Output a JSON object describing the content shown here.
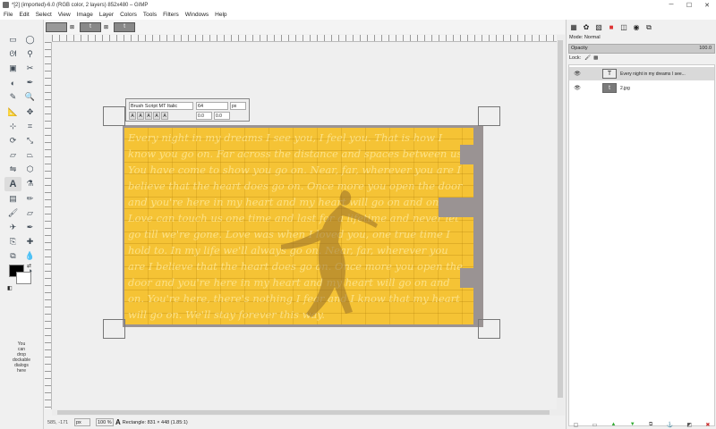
{
  "window": {
    "title": "*[2] (imported)-6.0 (RGB color, 2 layers) 852x480 – GIMP",
    "controls": {
      "minimize": "─",
      "maximize": "☐",
      "close": "✕"
    }
  },
  "menu": [
    "File",
    "Edit",
    "Select",
    "View",
    "Image",
    "Layer",
    "Colors",
    "Tools",
    "Filters",
    "Windows",
    "Help"
  ],
  "image_tabs": [
    {
      "glyph": "",
      "close": "⊠"
    },
    {
      "glyph": "t",
      "close": "⊠"
    },
    {
      "glyph": "t",
      "close": ""
    }
  ],
  "toolbox": {
    "tools": [
      {
        "name": "rect-select-icon",
        "glyph": "▭"
      },
      {
        "name": "ellipse-select-icon",
        "glyph": "◯"
      },
      {
        "name": "free-select-icon",
        "glyph": "ᘛ"
      },
      {
        "name": "fuzzy-select-icon",
        "glyph": "⚲"
      },
      {
        "name": "color-select-icon",
        "glyph": "▣"
      },
      {
        "name": "scissors-icon",
        "glyph": "✂"
      },
      {
        "name": "foreground-select-icon",
        "glyph": "◐"
      },
      {
        "name": "paths-icon",
        "glyph": "✒"
      },
      {
        "name": "color-picker-icon",
        "glyph": "✎"
      },
      {
        "name": "zoom-icon",
        "glyph": "🔍"
      },
      {
        "name": "measure-icon",
        "glyph": "📐"
      },
      {
        "name": "move-icon",
        "glyph": "✥"
      },
      {
        "name": "align-icon",
        "glyph": "⊹"
      },
      {
        "name": "crop-icon",
        "glyph": "⌗"
      },
      {
        "name": "rotate-icon",
        "glyph": "⟳"
      },
      {
        "name": "scale-icon",
        "glyph": "⤡"
      },
      {
        "name": "shear-icon",
        "glyph": "▱"
      },
      {
        "name": "perspective-icon",
        "glyph": "⏢"
      },
      {
        "name": "flip-icon",
        "glyph": "⇋"
      },
      {
        "name": "cage-icon",
        "glyph": "⬡"
      },
      {
        "name": "text-icon",
        "glyph": "A"
      },
      {
        "name": "bucket-fill-icon",
        "glyph": "⚗"
      },
      {
        "name": "blend-icon",
        "glyph": "▤"
      },
      {
        "name": "pencil-icon",
        "glyph": "✏"
      },
      {
        "name": "paintbrush-icon",
        "glyph": "🖌"
      },
      {
        "name": "eraser-icon",
        "glyph": "▱"
      },
      {
        "name": "airbrush-icon",
        "glyph": "✈"
      },
      {
        "name": "ink-icon",
        "glyph": "✒"
      },
      {
        "name": "clone-icon",
        "glyph": "⎘"
      },
      {
        "name": "heal-icon",
        "glyph": "✚"
      },
      {
        "name": "perspective-clone-icon",
        "glyph": "⧉"
      },
      {
        "name": "blur-icon",
        "glyph": "💧"
      },
      {
        "name": "smudge-icon",
        "glyph": "☝"
      },
      {
        "name": "dodge-burn-icon",
        "glyph": "◑"
      }
    ],
    "active_tool": "text-icon",
    "drop_hint": "You\ncan\ndrop\ndockable\ndialogs\nhere"
  },
  "text_toolbox": {
    "font": "Brush Script MT Italic",
    "size": "64",
    "unit": "px",
    "baseline": "0.0",
    "kerning": "0.0",
    "style_buttons": [
      "A",
      "A",
      "A",
      "A",
      "A"
    ]
  },
  "canvas": {
    "script_text": "Every night in my dreams I see you, I feel you. That is how I know you go on. Far across the distance and spaces between us. You have come to show you go on. Near, far, wherever you are I believe that the heart does go on. Once more you open the door and you're here in my heart and my heart will go on and on. Love can touch us one time and last for a lifetime and never let go till we're gone. Love was when I loved you, one true time I hold to. In my life we'll always go on. Near, far, wherever you are I believe that the heart does go on. Once more you open the door and you're here in my heart and my heart will go on and on. You're here, there's nothing I fear and I know that my heart will go on. We'll stay forever this way."
  },
  "status": {
    "coords": "585, -171",
    "unit": "px",
    "zoom": "100 %",
    "message": "Rectangle: 831 × 448  (1.85:1)"
  },
  "layers_panel": {
    "mode_label": "Mode: Normal",
    "opacity_label": "Opacity",
    "opacity_value": "100.0",
    "lock_label": "Lock:",
    "layers": [
      {
        "name": "Every night in my dreams I see...",
        "thumb": "T",
        "type": "text",
        "selected": true
      },
      {
        "name": "2.jpg",
        "thumb": "t",
        "type": "image",
        "selected": false
      }
    ],
    "bottom_icons": [
      "new-layer-icon",
      "new-group-icon",
      "raise-icon",
      "lower-icon",
      "duplicate-icon",
      "anchor-icon",
      "mask-icon",
      "delete-icon"
    ]
  }
}
